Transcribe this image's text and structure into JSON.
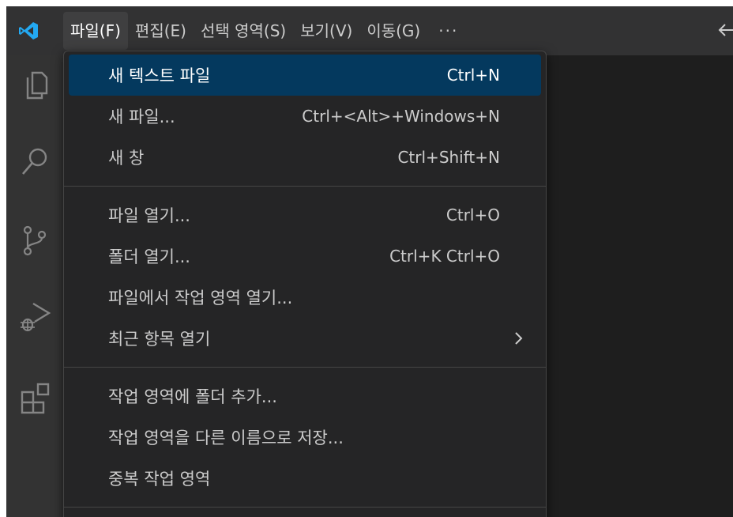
{
  "menubar": {
    "items": [
      {
        "label": "파일(F)"
      },
      {
        "label": "편집(E)"
      },
      {
        "label": "선택 영역(S)"
      },
      {
        "label": "보기(V)"
      },
      {
        "label": "이동(G)"
      }
    ],
    "more": "···"
  },
  "file_menu": {
    "groups": [
      [
        {
          "label": "새 텍스트 파일",
          "shortcut": "Ctrl+N"
        },
        {
          "label": "새 파일...",
          "shortcut": "Ctrl+<Alt>+Windows+N"
        },
        {
          "label": "새 창",
          "shortcut": "Ctrl+Shift+N"
        }
      ],
      [
        {
          "label": "파일 열기...",
          "shortcut": "Ctrl+O"
        },
        {
          "label": "폴더 열기...",
          "shortcut": "Ctrl+K Ctrl+O"
        },
        {
          "label": "파일에서 작업 영역 열기..."
        },
        {
          "label": "최근 항목 열기"
        }
      ],
      [
        {
          "label": "작업 영역에 폴더 추가..."
        },
        {
          "label": "작업 영역을 다른 이름으로 저장..."
        },
        {
          "label": "중복 작업 영역"
        }
      ]
    ]
  },
  "colors": {
    "titlebar": "#323233",
    "activitybar": "#333333",
    "menu_bg": "#252526",
    "highlight": "#04395e",
    "vscode_blue": "#23a9f2"
  },
  "icons": {
    "app": "vscode-logo-icon",
    "back": "arrow-left-icon",
    "activity": [
      "explorer-icon",
      "search-icon",
      "source-control-icon",
      "run-debug-icon",
      "extensions-icon"
    ],
    "submenu": "chevron-right-icon"
  }
}
